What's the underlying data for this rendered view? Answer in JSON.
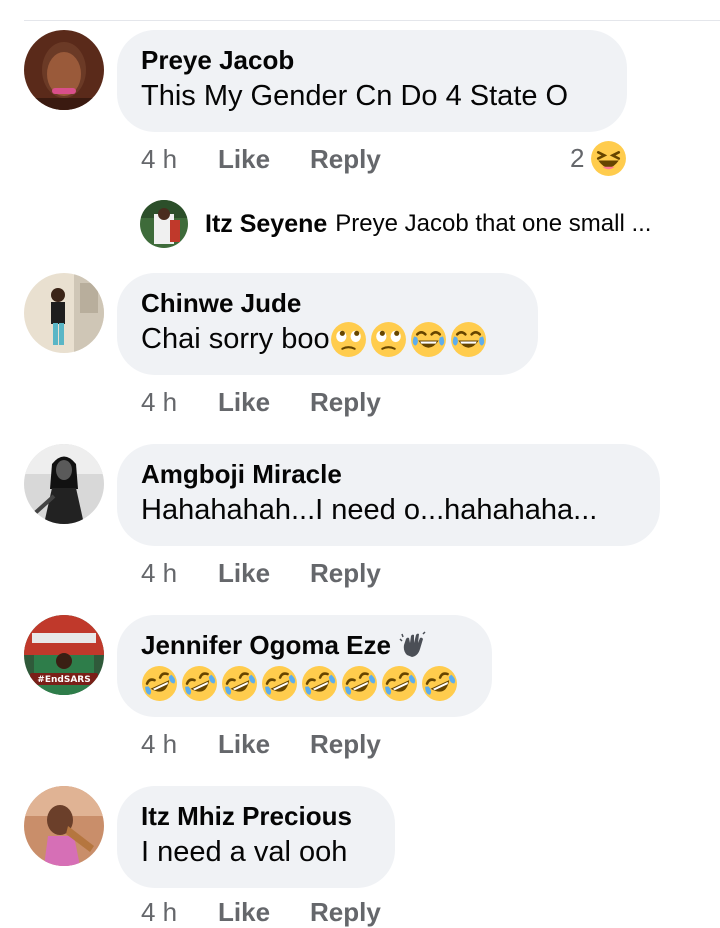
{
  "comments": [
    {
      "author": "Preye Jacob",
      "text": "This My Gender Cn Do 4 State O",
      "time": "4 h",
      "like": "Like",
      "reply": "Reply",
      "reaction_count": "2",
      "reaction_icon": "laughing-squint-emoji",
      "emojis": []
    },
    {
      "author": "Chinwe Jude",
      "text": "Chai sorry boo",
      "time": "4 h",
      "like": "Like",
      "reply": "Reply",
      "emojis": [
        "eye-roll-emoji",
        "eye-roll-emoji",
        "tears-of-joy-emoji",
        "tears-of-joy-emoji"
      ]
    },
    {
      "author": "Amgboji Miracle",
      "text": "Hahahahah...I need o...hahahaha...",
      "time": "4 h",
      "like": "Like",
      "reply": "Reply",
      "emojis": []
    },
    {
      "author": "Jennifer Ogoma Eze",
      "text": "",
      "time": "4 h",
      "like": "Like",
      "reply": "Reply",
      "author_badge": "waving-hand-icon",
      "avatar_caption": "#EndSARS",
      "emojis": [
        "rolling-laughing-emoji",
        "rolling-laughing-emoji",
        "rolling-laughing-emoji",
        "rolling-laughing-emoji",
        "rolling-laughing-emoji",
        "rolling-laughing-emoji",
        "rolling-laughing-emoji",
        "rolling-laughing-emoji"
      ]
    },
    {
      "author": "Itz Mhiz Precious",
      "text": "I need a val ooh",
      "time": "4 h",
      "like": "Like",
      "reply": "Reply",
      "emojis": []
    }
  ],
  "reply_preview": {
    "author": "Itz Seyene",
    "text": "Preye Jacob that one small ..."
  },
  "colors": {
    "bubble": "#f0f2f5",
    "meta_text": "#65676b",
    "emoji_yellow": "#ffcc4d",
    "tears_blue": "#5dadec"
  }
}
